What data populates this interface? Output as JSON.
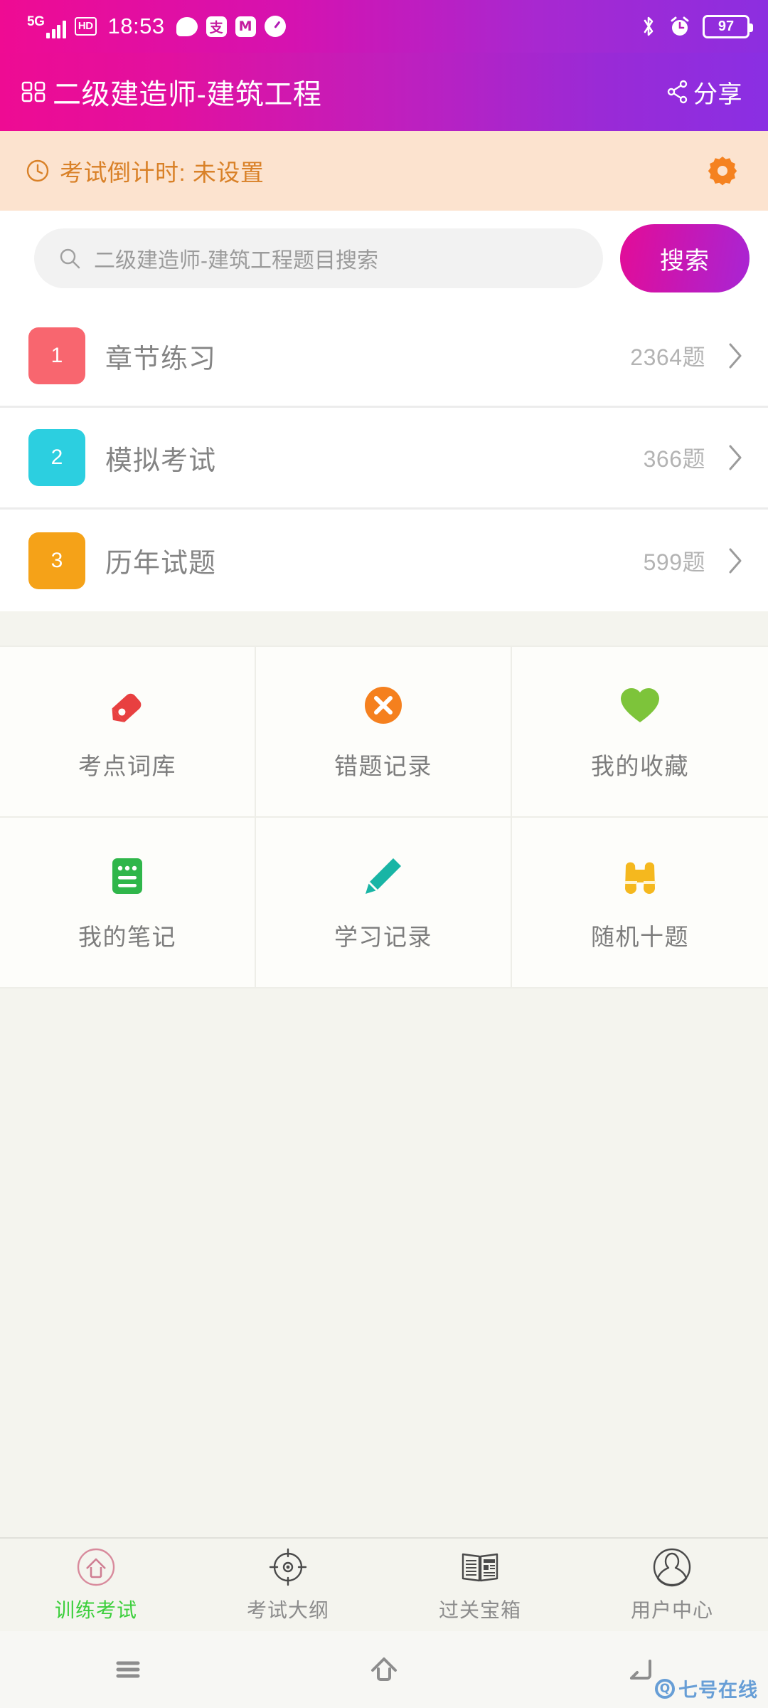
{
  "statusbar": {
    "network": "5G",
    "hd": "HD",
    "time": "18:53",
    "app_icons": [
      "chat-bubble-icon",
      "alipay-icon",
      "meitu-icon",
      "speedometer-icon"
    ],
    "bluetooth": "bluetooth-icon",
    "alarm": "alarm-clock-icon",
    "battery_percent": "97"
  },
  "header": {
    "grid_icon": "grid-icon",
    "title": "二级建造师-建筑工程",
    "share_icon": "share-icon",
    "share_label": "分享",
    "gradient_start": "#ee0b93",
    "gradient_end": "#8a2fe3"
  },
  "countdown": {
    "clock_icon": "clock-icon",
    "text": "考试倒计时: 未设置",
    "gear_icon": "gear-icon",
    "background": "#fce3cf",
    "text_color": "#d98128",
    "gear_color": "#f58220"
  },
  "search": {
    "icon": "search-icon",
    "placeholder": "二级建造师-建筑工程题目搜索",
    "value": "",
    "button_label": "搜索"
  },
  "menu": {
    "items": [
      {
        "number": "1",
        "label": "章节练习",
        "count": "2364题",
        "color": "#f8666f",
        "chevron": "chevron-right-icon"
      },
      {
        "number": "2",
        "label": "模拟考试",
        "count": "366题",
        "color": "#2ccfe0",
        "chevron": "chevron-right-icon"
      },
      {
        "number": "3",
        "label": "历年试题",
        "count": "599题",
        "color": "#f5a218",
        "chevron": "chevron-right-icon"
      }
    ]
  },
  "features": {
    "cells": [
      {
        "label": "考点词库",
        "icon": "tag-icon",
        "color": "#e84040"
      },
      {
        "label": "错题记录",
        "icon": "circle-x-icon",
        "color": "#f5801e"
      },
      {
        "label": "我的收藏",
        "icon": "heart-icon",
        "color": "#7dc43a"
      },
      {
        "label": "我的笔记",
        "icon": "note-icon",
        "color": "#2fb64a"
      },
      {
        "label": "学习记录",
        "icon": "pencil-icon",
        "color": "#19b5a5"
      },
      {
        "label": "随机十题",
        "icon": "binoculars-icon",
        "color": "#f5b81e"
      }
    ]
  },
  "tabbar": {
    "active_index": 0,
    "active_color": "#3ccf3c",
    "items": [
      {
        "label": "训练考试",
        "icon": "home-circle-icon"
      },
      {
        "label": "考试大纲",
        "icon": "target-icon"
      },
      {
        "label": "过关宝箱",
        "icon": "newspaper-icon"
      },
      {
        "label": "用户中心",
        "icon": "user-circle-icon"
      }
    ]
  },
  "navbar": {
    "buttons": [
      {
        "icon": "menu-icon"
      },
      {
        "icon": "home-icon"
      },
      {
        "icon": "back-icon"
      }
    ]
  },
  "watermark": {
    "badge": "Q",
    "text": "七号在线"
  }
}
